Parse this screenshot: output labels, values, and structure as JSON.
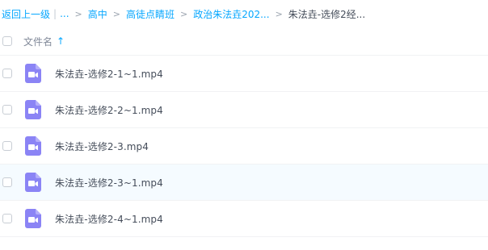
{
  "breadcrumb": {
    "back": "返回上一级",
    "ellipsis": "...",
    "items": [
      "高中",
      "高徒点睛班",
      "政治朱法垚202..."
    ],
    "current": "朱法垚-选修2经..."
  },
  "list_header": {
    "column_label": "文件名",
    "sort_icon": "sort-ascending-icon"
  },
  "files": [
    {
      "name": "朱法垚-选修2-1~1.mp4",
      "icon": "video-file-icon"
    },
    {
      "name": "朱法垚-选修2-2~1.mp4",
      "icon": "video-file-icon"
    },
    {
      "name": "朱法垚-选修2-3.mp4",
      "icon": "video-file-icon"
    },
    {
      "name": "朱法垚-选修2-3~1.mp4",
      "icon": "video-file-icon"
    },
    {
      "name": "朱法垚-选修2-4~1.mp4",
      "icon": "video-file-icon"
    }
  ],
  "colors": {
    "accent": "#06a7ff",
    "video_icon": "#8b84f5"
  }
}
